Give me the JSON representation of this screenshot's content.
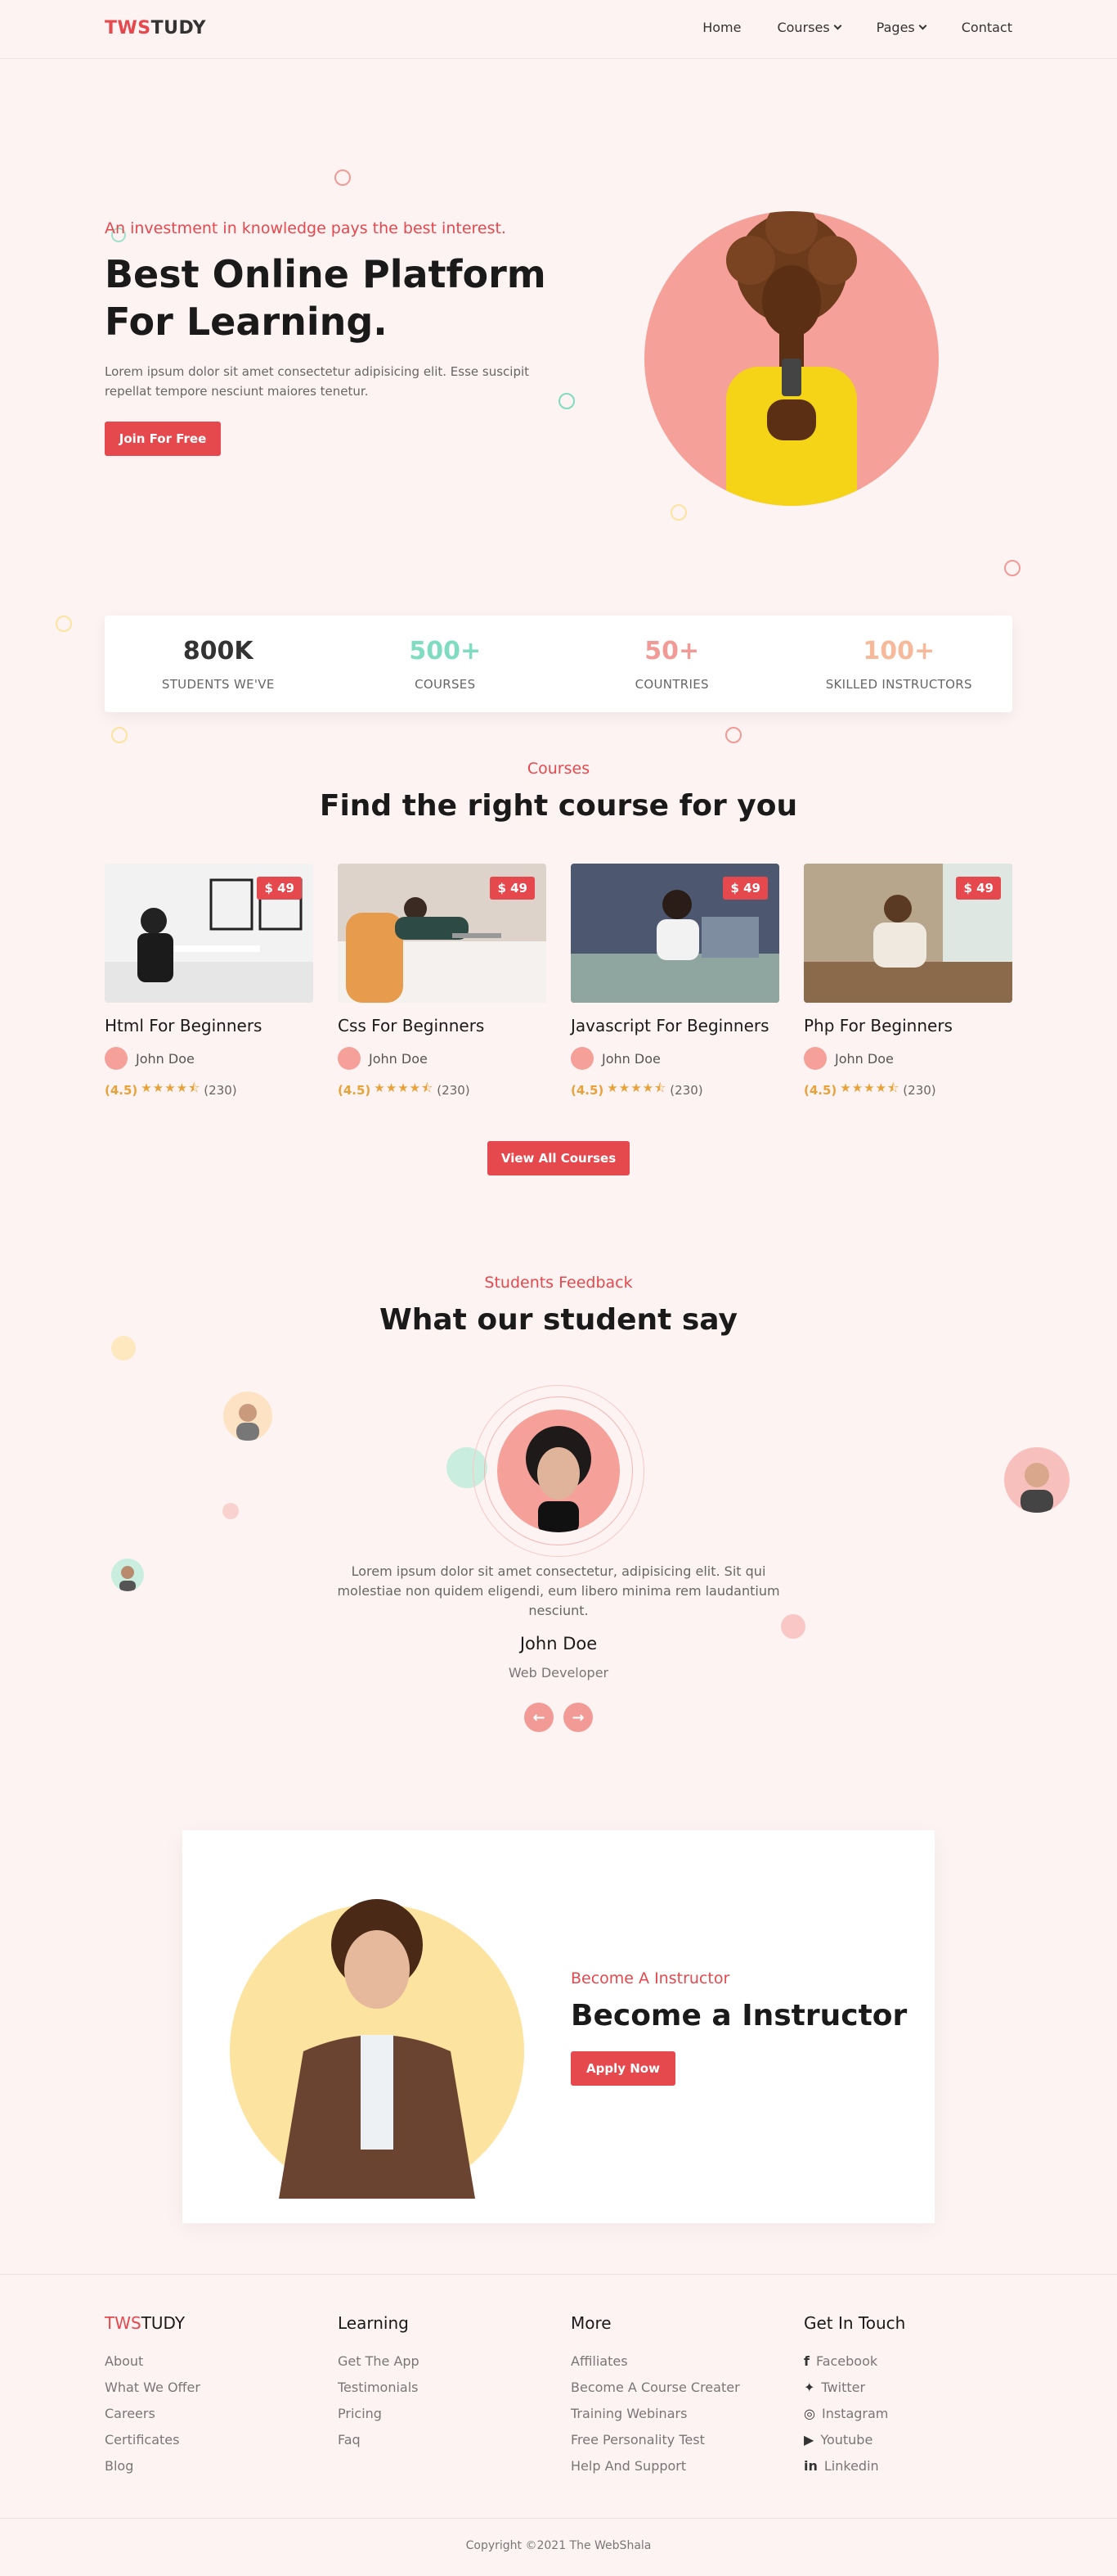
{
  "header": {
    "logo_prefix": "TWS",
    "logo_suffix": "TUDY",
    "nav": [
      "Home",
      "Courses",
      "Pages",
      "Contact"
    ]
  },
  "hero": {
    "tagline": "An investment in knowledge pays the best interest.",
    "title": "Best Online Platform For Learning.",
    "description": "Lorem ipsum dolor sit amet consectetur adipisicing elit. Esse suscipit repellat tempore nesciunt maiores tenetur.",
    "cta": "Join For Free"
  },
  "stats": [
    {
      "value": "800K",
      "label": "STUDENTS WE'VE",
      "color": "#333333"
    },
    {
      "value": "500+",
      "label": "COURSES",
      "color": "#7fdcc0"
    },
    {
      "value": "50+",
      "label": "COUNTRIES",
      "color": "#f19a96"
    },
    {
      "value": "100+",
      "label": "SKILLED INSTRUCTORS",
      "color": "#f6b99a"
    }
  ],
  "courses": {
    "tag": "Courses",
    "title": "Find the right course for you",
    "items": [
      {
        "title": "Html For Beginners",
        "price": "$ 49",
        "author": "John Doe",
        "score": "(4.5)",
        "count": "(230)"
      },
      {
        "title": "Css For Beginners",
        "price": "$ 49",
        "author": "John Doe",
        "score": "(4.5)",
        "count": "(230)"
      },
      {
        "title": "Javascript For Beginners",
        "price": "$ 49",
        "author": "John Doe",
        "score": "(4.5)",
        "count": "(230)"
      },
      {
        "title": "Php For Beginners",
        "price": "$ 49",
        "author": "John Doe",
        "score": "(4.5)",
        "count": "(230)"
      }
    ],
    "view_all": "View All Courses"
  },
  "feedback": {
    "tag": "Students Feedback",
    "title": "What our student say",
    "quote": "Lorem ipsum dolor sit amet consectetur, adipisicing elit. Sit qui molestiae non quidem eligendi, eum libero minima rem laudantium nesciunt.",
    "name": "John Doe",
    "role": "Web Developer"
  },
  "instructor": {
    "tag": "Become A Instructor",
    "title": "Become a Instructor",
    "cta": "Apply Now"
  },
  "footer": {
    "brand_prefix": "TWS",
    "brand_suffix": "TUDY",
    "col1": [
      "About",
      "What We Offer",
      "Careers",
      "Certificates",
      "Blog"
    ],
    "learning_title": "Learning",
    "col2": [
      "Get The App",
      "Testimonials",
      "Pricing",
      "Faq"
    ],
    "more_title": "More",
    "col3": [
      "Affiliates",
      "Become A Course Creater",
      "Training Webinars",
      "Free Personality Test",
      "Help And Support"
    ],
    "contact_title": "Get In Touch",
    "col4": [
      "Facebook",
      "Twitter",
      "Instagram",
      "Youtube",
      "Linkedin"
    ],
    "copyright": "Copyright ©2021 The WebShala"
  }
}
